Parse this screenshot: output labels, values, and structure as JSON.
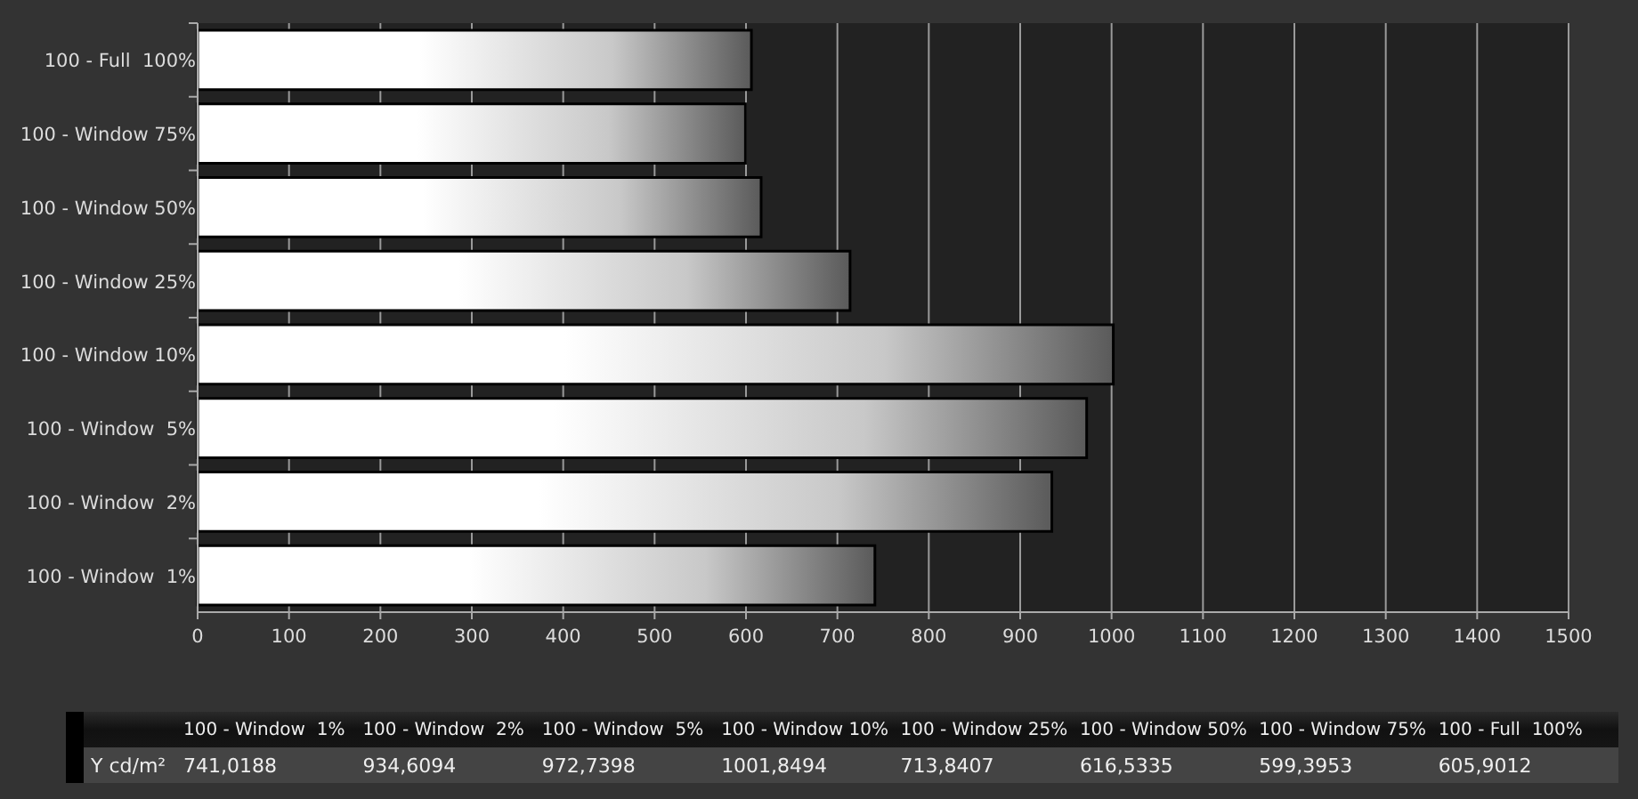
{
  "chart": {
    "chart_data": {
      "type": "bar",
      "orientation": "horizontal",
      "categories": [
        "100 - Full  100%",
        "100 - Window 75%",
        "100 - Window 50%",
        "100 - Window 25%",
        "100 - Window 10%",
        "100 - Window  5%",
        "100 - Window  2%",
        "100 - Window  1%"
      ],
      "series": [
        {
          "values": [
            605.9012,
            599.3953,
            616.5335,
            713.8407,
            1001.8494,
            972.7398,
            934.6094,
            741.0188
          ]
        }
      ],
      "grid": true,
      "xlim": [
        0,
        1500
      ],
      "xticks": [
        0,
        100,
        200,
        300,
        400,
        500,
        600,
        700,
        800,
        900,
        1000,
        1100,
        1200,
        1300,
        1400,
        1500
      ]
    }
  },
  "table": {
    "columns": [
      "100 - Window  1%",
      "100 - Window  2%",
      "100 - Window  5%",
      "100 - Window 10%",
      "100 - Window 25%",
      "100 - Window 50%",
      "100 - Window 75%",
      "100 - Full  100%"
    ],
    "rows": [
      {
        "label": "Y cd/m²",
        "cells": [
          "741,0188",
          "934,6094",
          "972,7398",
          "1001,8494",
          "713,8407",
          "616,5335",
          "599,3953",
          "605,9012"
        ]
      }
    ]
  }
}
